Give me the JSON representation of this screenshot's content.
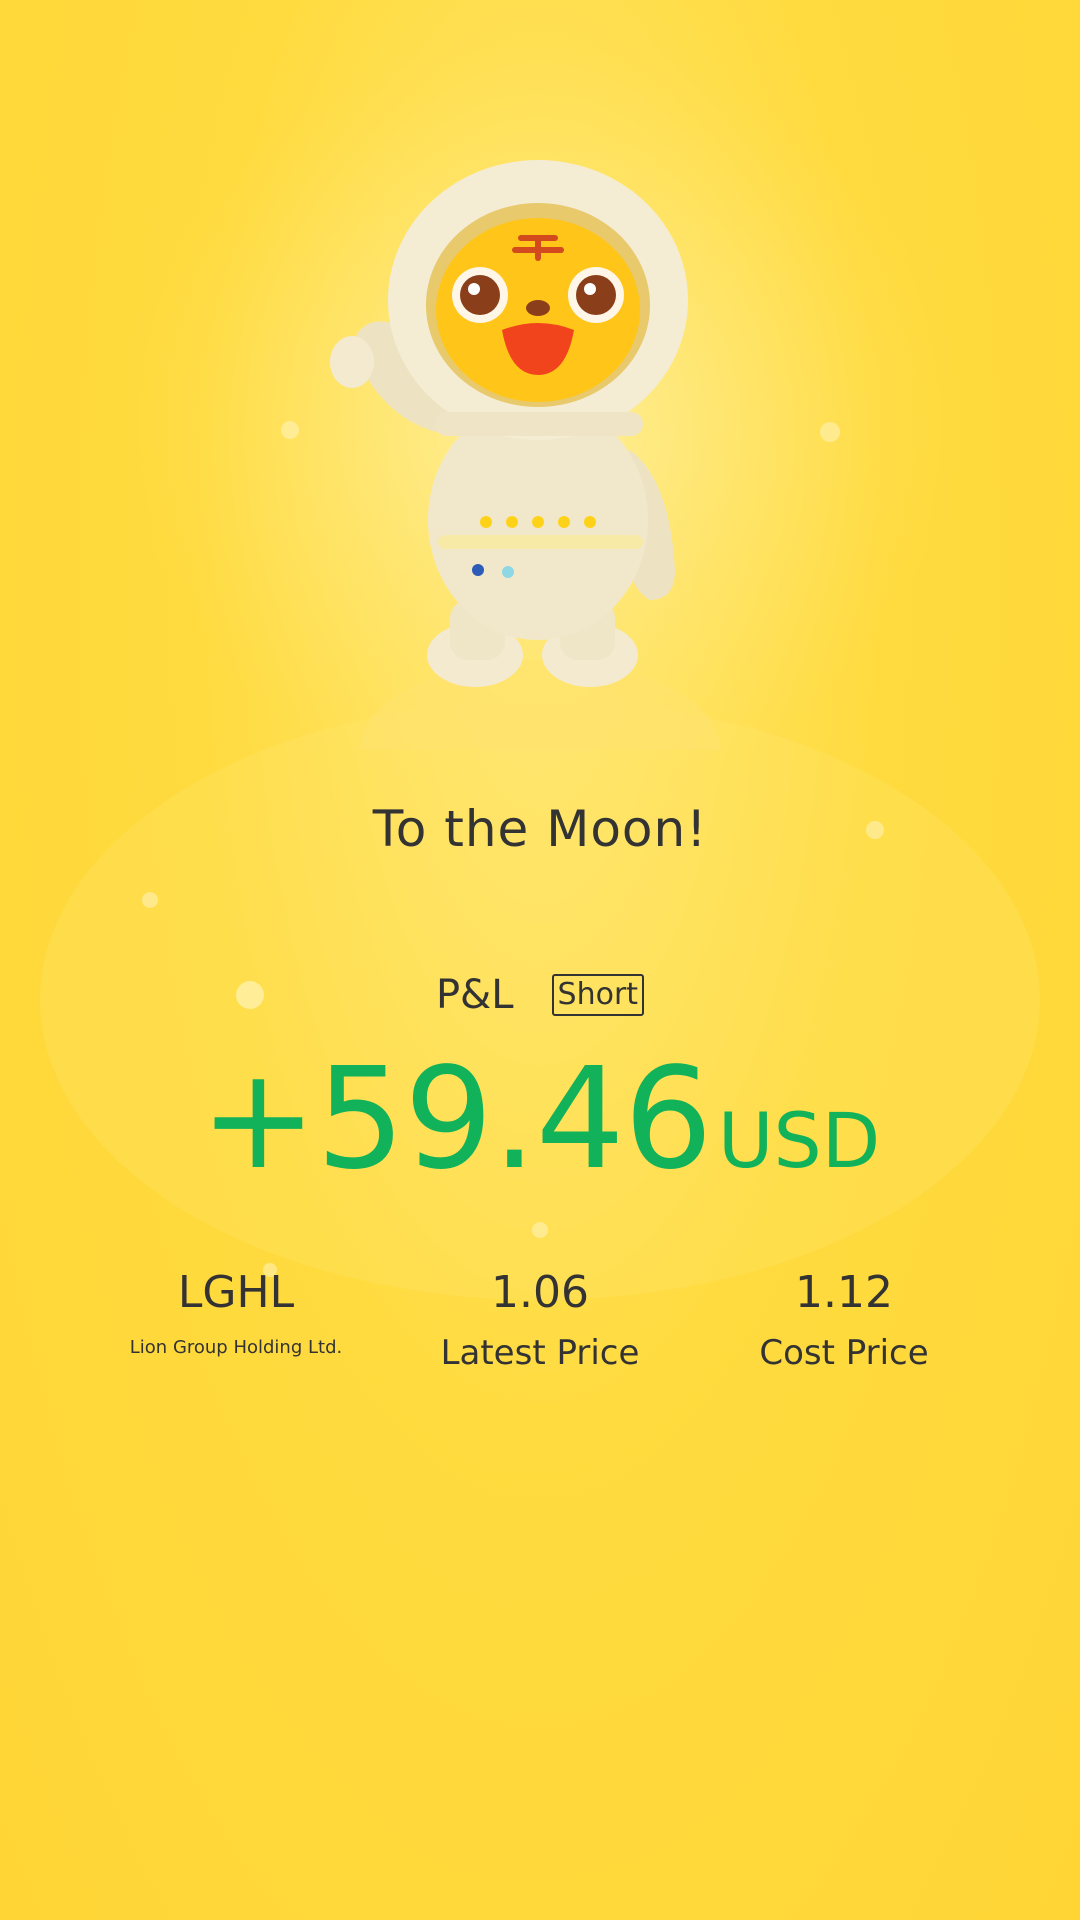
{
  "headline": "To the Moon!",
  "pnl": {
    "label": "P&L",
    "position_type": "Short",
    "amount": "+59.46",
    "currency": "USD"
  },
  "stock": {
    "ticker": "LGHL",
    "company_name": "Lion Group Holding Ltd."
  },
  "latest_price": {
    "value": "1.06",
    "label": "Latest Price"
  },
  "cost_price": {
    "value": "1.12",
    "label": "Cost Price"
  },
  "colors": {
    "background": "#ffd535",
    "profit": "#12b25a",
    "text": "#333333"
  },
  "icons": {
    "mascot": "tiger-astronaut-mascot-icon"
  }
}
